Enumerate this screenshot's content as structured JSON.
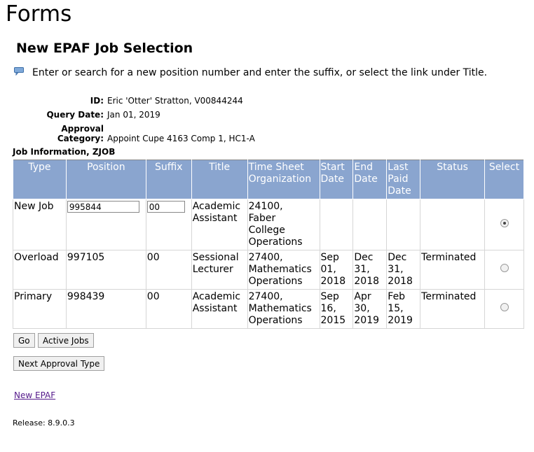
{
  "page": {
    "heading": "Forms",
    "title": "New EPAF Job Selection",
    "info_text": "Enter or search for a new position number and enter the suffix, or select the link under Title."
  },
  "details": {
    "id_label": "ID:",
    "id_value": "Eric 'Otter' Stratton, V00844244",
    "query_date_label": "Query Date:",
    "query_date_value": "Jan 01, 2019",
    "approval_label": "Approval Category:",
    "approval_value": "Appoint Cupe 4163 Comp 1, HC1-A"
  },
  "job_section": {
    "label": "Job Information, ZJOB",
    "headers": {
      "type": "Type",
      "position": "Position",
      "suffix": "Suffix",
      "title": "Title",
      "tso_line1": "Time Sheet",
      "tso_line2": "Organization",
      "start_line1": "Start",
      "start_line2": "Date",
      "end_line1": "End",
      "end_line2": "Date",
      "lpd_line1": "Last",
      "lpd_line2": "Paid",
      "lpd_line3": "Date",
      "status": "Status",
      "select": "Select"
    },
    "rows": [
      {
        "type": "New Job",
        "position_value": "995844",
        "suffix_value": "00",
        "title_line1": "Academic",
        "title_line2": "Assistant",
        "org_line1": "24100,",
        "org_line2": "Faber",
        "org_line3": "College",
        "org_line4": "Operations",
        "selected": true
      },
      {
        "type": "Overload",
        "position": "997105",
        "suffix": "00",
        "title_line1": "Sessional",
        "title_line2": "Lecturer",
        "org_line1": "27400,",
        "org_line2": "Mathematics",
        "org_line3": "Operations",
        "start_line1": "Sep",
        "start_line2": "01,",
        "start_line3": "2018",
        "end_line1": "Dec",
        "end_line2": "31,",
        "end_line3": "2018",
        "lpd_line1": "Dec",
        "lpd_line2": "31,",
        "lpd_line3": "2018",
        "status": "Terminated",
        "selected": false
      },
      {
        "type": "Primary",
        "position": "998439",
        "suffix": "00",
        "title_line1": "Academic",
        "title_line2": "Assistant",
        "org_line1": "27400,",
        "org_line2": "Mathematics",
        "org_line3": "Operations",
        "start_line1": "Sep",
        "start_line2": "16,",
        "start_line3": "2015",
        "end_line1": "Apr",
        "end_line2": "30,",
        "end_line3": "2019",
        "lpd_line1": "Feb",
        "lpd_line2": "15,",
        "lpd_line3": "2019",
        "status": "Terminated",
        "selected": false
      }
    ]
  },
  "buttons": {
    "go": "Go",
    "active_jobs": "Active Jobs",
    "next_approval_type": "Next Approval Type"
  },
  "links": {
    "new_epaf": "New EPAF"
  },
  "footer": {
    "release": "Release: 8.9.0.3"
  },
  "colors": {
    "header_bg": "#8aa5cf",
    "link": "#551a8b"
  }
}
